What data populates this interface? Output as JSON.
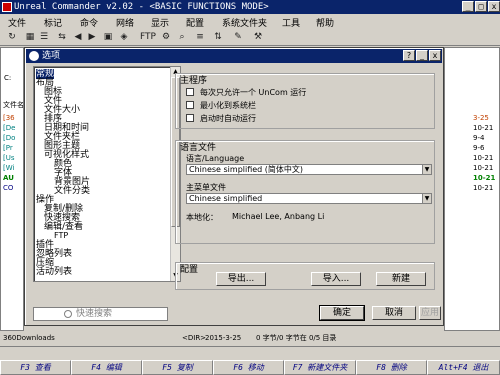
{
  "app": {
    "title": "Unreal Commander v2.02 - <BASIC FUNCTIONS MODE>"
  },
  "menu": [
    "文件",
    "标记",
    "命令",
    "网络",
    "显示",
    "配置",
    "系统文件夹",
    "工具",
    "帮助"
  ],
  "toolbar": {
    "ftp_label": "FTP"
  },
  "background": {
    "drive_label": "C:",
    "left_list_header": "文件名",
    "left_items": [
      "[36",
      "[De",
      "[Do",
      "[Pr",
      "[Us",
      "[Wi",
      "AU",
      "CO"
    ],
    "right_items": [
      "3-25",
      "10-21",
      "9-4",
      "9-6",
      "10-21",
      "10-21",
      "10-21",
      "10-21"
    ],
    "current_entry": "360Downloads",
    "dir_tag": "<DIR>",
    "dir_date": "2015-3-25",
    "selection_info": "0 字节/0 字节在 0/5 目录"
  },
  "dialog": {
    "title": "选项",
    "title_buttons": [
      "?",
      "_",
      "x"
    ],
    "tree": [
      {
        "label": "常规",
        "level": 0,
        "selected": true
      },
      {
        "label": "布局",
        "level": 0
      },
      {
        "label": "图标",
        "level": 1
      },
      {
        "label": "文件",
        "level": 1
      },
      {
        "label": "文件大小",
        "level": 1
      },
      {
        "label": "排序",
        "level": 1
      },
      {
        "label": "日期和时间",
        "level": 1
      },
      {
        "label": "文件夹栏",
        "level": 1
      },
      {
        "label": "图形主题",
        "level": 1
      },
      {
        "label": "可视化样式",
        "level": 1
      },
      {
        "label": "颜色",
        "level": 2
      },
      {
        "label": "字体",
        "level": 2
      },
      {
        "label": "背景图片",
        "level": 2
      },
      {
        "label": "文件分类",
        "level": 2
      },
      {
        "label": "操作",
        "level": 0
      },
      {
        "label": "复制/删除",
        "level": 1
      },
      {
        "label": "快速搜索",
        "level": 1
      },
      {
        "label": "编辑/查看",
        "level": 1
      },
      {
        "label": "FTP",
        "level": 1
      },
      {
        "label": "插件",
        "level": 0
      },
      {
        "label": "忽略列表",
        "level": 0
      },
      {
        "label": "压缩",
        "level": 0
      },
      {
        "label": "活动列表",
        "level": 0
      }
    ],
    "quick_search": "快速搜索",
    "main_group": {
      "label": "主程序",
      "options": [
        {
          "label": "每次只允许一个 UnCom 运行",
          "checked": false
        },
        {
          "label": "最小化到系统栏",
          "checked": false
        },
        {
          "label": "启动时自动运行",
          "checked": false
        }
      ]
    },
    "language_group": {
      "label": "语言文件",
      "language_label": "语言/Language",
      "language_value": "Chinese simplified (简体中文)",
      "menu_label": "主菜单文件",
      "menu_value": "Chinese simplified",
      "localization_label": "本地化：",
      "localization_value": "Michael Lee, Anbang Li"
    },
    "config_group": {
      "label": "配置",
      "export": "导出...",
      "import": "导入...",
      "new": "新建"
    },
    "ok": "确定",
    "cancel": "取消",
    "apply": "应用"
  },
  "fkeys": [
    "F3 查看",
    "F4 编辑",
    "F5 复制",
    "F6 移动",
    "F7 新建文件夹",
    "F8 删除",
    "Alt+F4 退出"
  ]
}
